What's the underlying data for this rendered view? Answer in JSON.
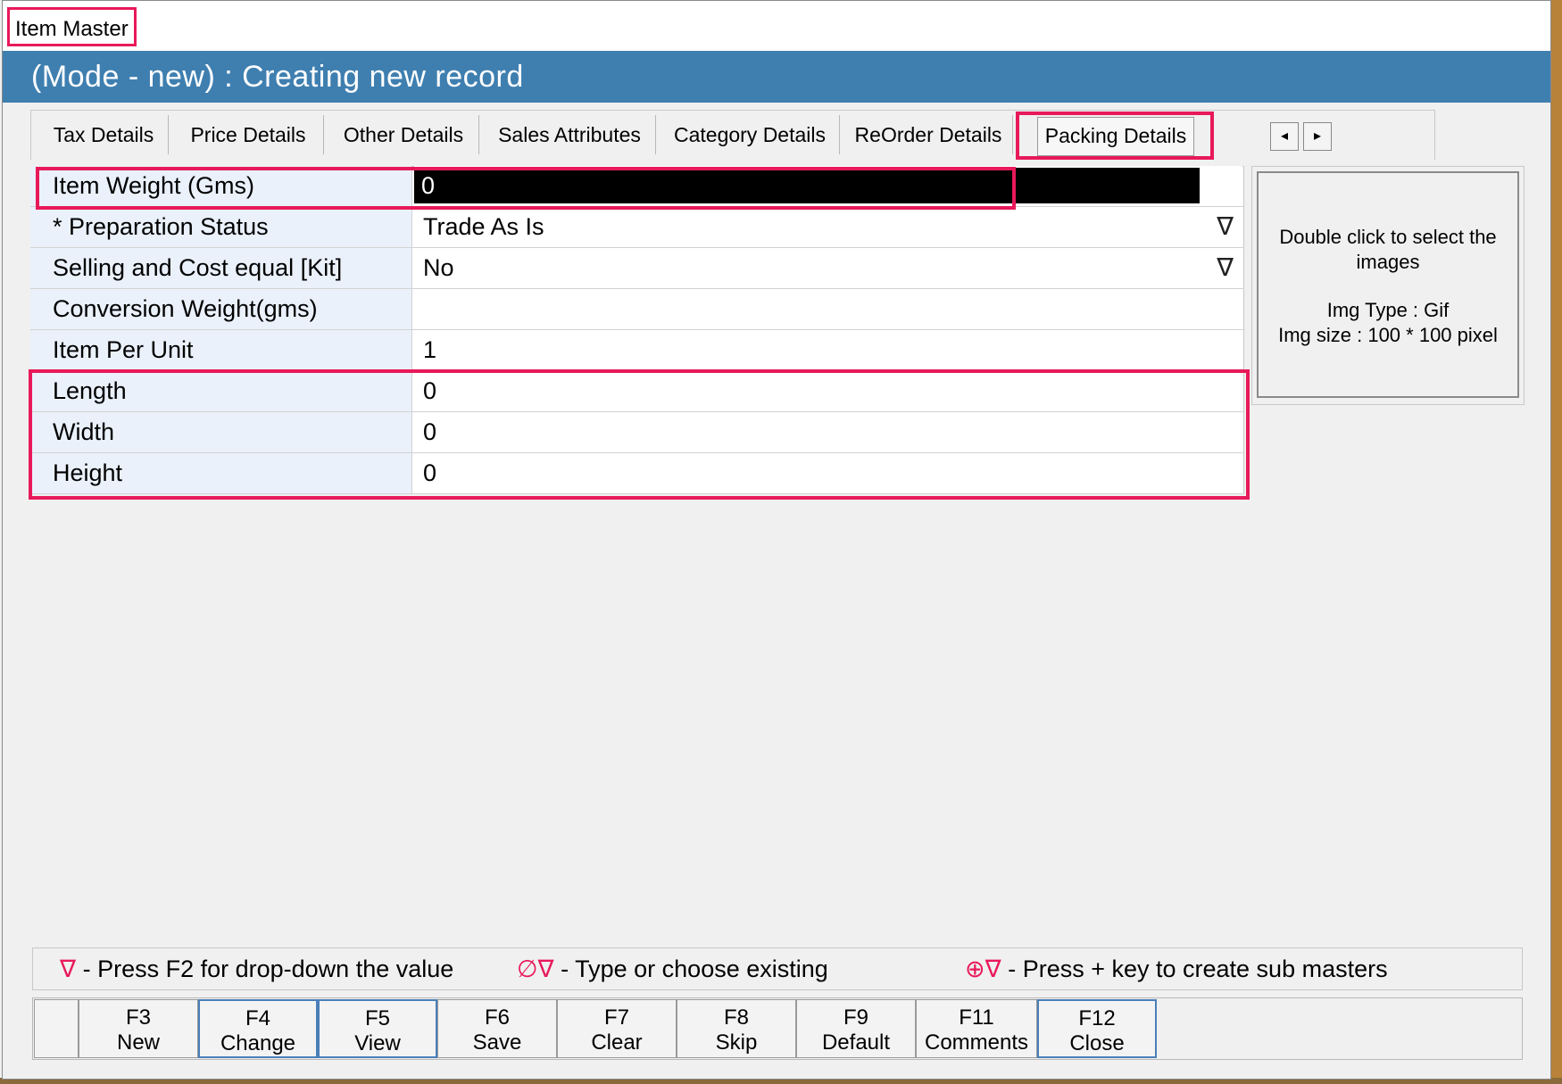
{
  "window": {
    "title": "Item Master"
  },
  "banner": {
    "text": "(Mode - new) : Creating new record"
  },
  "tabs": [
    {
      "label": "Tax Details"
    },
    {
      "label": "Price Details"
    },
    {
      "label": "Other Details"
    },
    {
      "label": "Sales Attributes"
    },
    {
      "label": "Category Details"
    },
    {
      "label": "ReOrder Details"
    },
    {
      "label": "Packing Details",
      "selected": true
    }
  ],
  "tab_scroll": {
    "left_icon": "◂",
    "right_icon": "▸"
  },
  "grid": {
    "rows": [
      {
        "label": "Item Weight (Gms)",
        "value": "0"
      },
      {
        "label": "* Preparation Status",
        "value": "Trade As Is",
        "dropdown": true
      },
      {
        "label": "Selling and Cost equal [Kit]",
        "value": "No",
        "dropdown": true
      },
      {
        "label": "Conversion Weight(gms)",
        "value": ""
      },
      {
        "label": "Item Per Unit",
        "value": "1"
      },
      {
        "label": "Length",
        "value": "0"
      },
      {
        "label": "Width",
        "value": "0"
      },
      {
        "label": "Height",
        "value": "0"
      }
    ],
    "dropdown_icon": "∇"
  },
  "image_panel": {
    "line1": "Double click to select the",
    "line2": "images",
    "line3": "Img Type : Gif",
    "line4": "Img size : 100 * 100 pixel"
  },
  "legend": {
    "item1_icon": "∇",
    "item1_text": "- Press F2 for drop-down the value",
    "item2_icon": "∅∇",
    "item2_text": "- Type or choose existing",
    "item3_icon": "⊕∇",
    "item3_text": "- Press + key to create sub masters"
  },
  "fkeys": [
    {
      "key": "F3",
      "label": "New"
    },
    {
      "key": "F4",
      "label": "Change"
    },
    {
      "key": "F5",
      "label": "View"
    },
    {
      "key": "F6",
      "label": "Save"
    },
    {
      "key": "F7",
      "label": "Clear"
    },
    {
      "key": "F8",
      "label": "Skip"
    },
    {
      "key": "F9",
      "label": "Default"
    },
    {
      "key": "F11",
      "label": "Comments"
    },
    {
      "key": "F12",
      "label": "Close"
    }
  ],
  "colors": {
    "banner": "#3f7fb0",
    "highlight": "#e8195a",
    "label_bg": "#eaf1fb"
  }
}
